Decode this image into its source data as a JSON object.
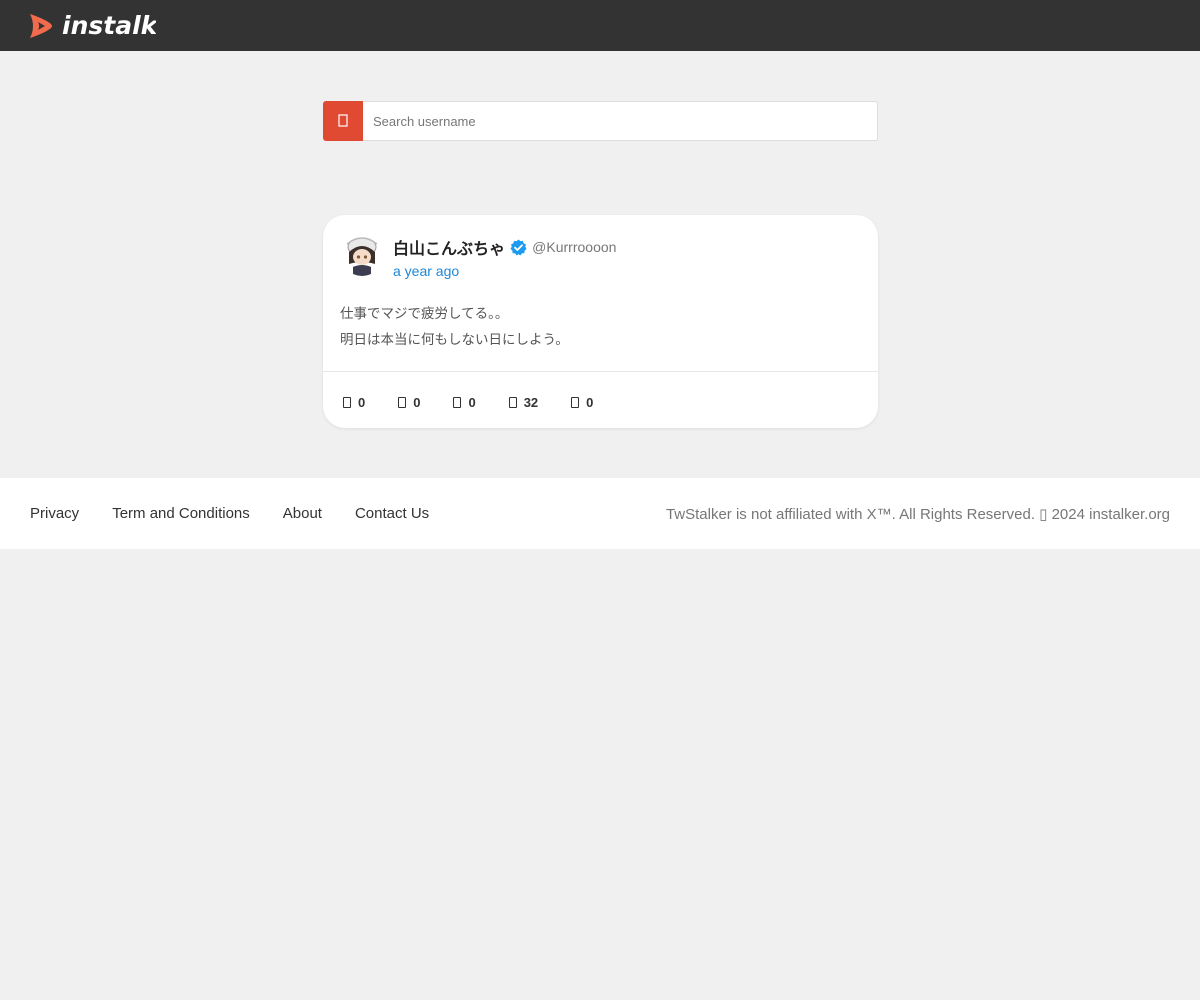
{
  "header": {
    "logo_text": "instalk",
    "logo_icon": "play-arrow-logo-icon",
    "logo_color": "#f26b4d",
    "bar_color": "#333333"
  },
  "search": {
    "placeholder": "Search username",
    "button_icon": "search-icon",
    "button_color": "#e04a32"
  },
  "tweet": {
    "author_name": "白山こんぶちゃ",
    "verified": true,
    "verified_color": "#1d9bf0",
    "handle": "@Kurrroooon",
    "timestamp": "a year ago",
    "text_lines": [
      "仕事でマジで疲労してる。。",
      "明日は本当に何もしない日にしよう。"
    ],
    "stats": [
      {
        "icon": "reply-icon",
        "value": "0"
      },
      {
        "icon": "retweet-icon",
        "value": "0"
      },
      {
        "icon": "quote-icon",
        "value": "0"
      },
      {
        "icon": "like-icon",
        "value": "32"
      },
      {
        "icon": "view-icon",
        "value": "0"
      }
    ]
  },
  "footer": {
    "links": [
      "Privacy",
      "Term and Conditions",
      "About",
      "Contact Us"
    ],
    "copyright": "TwStalker is not affiliated with X™. All Rights Reserved. ▯ 2024 instalker.org"
  }
}
